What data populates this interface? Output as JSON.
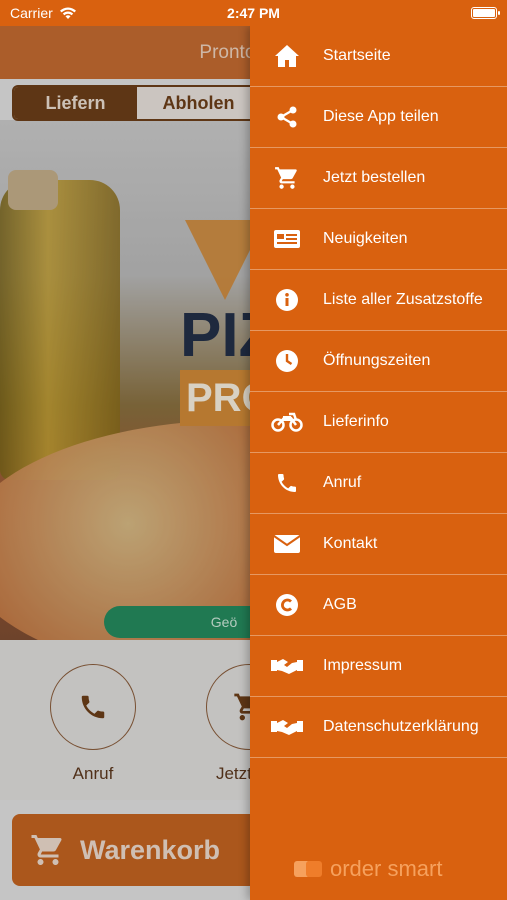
{
  "status": {
    "carrier": "Carrier",
    "time": "2:47 PM"
  },
  "app": {
    "title": "Pronto Pi",
    "tabs": [
      {
        "label": "Liefern",
        "active": true
      },
      {
        "label": "Abholen",
        "active": false
      }
    ],
    "logo": {
      "line1": "PIZ",
      "line2": "PRO"
    },
    "open_status": "Geö",
    "actions": [
      {
        "label": "Anruf",
        "icon": "phone-icon"
      },
      {
        "label": "Jetzt b",
        "icon": "cart-icon"
      }
    ],
    "cart_label": "Warenkorb"
  },
  "drawer": {
    "items": [
      {
        "label": "Startseite",
        "icon": "home-icon"
      },
      {
        "label": "Diese App teilen",
        "icon": "share-icon"
      },
      {
        "label": "Jetzt bestellen",
        "icon": "cart-icon"
      },
      {
        "label": "Neuigkeiten",
        "icon": "news-icon"
      },
      {
        "label": "Liste aller Zusatzstoffe",
        "icon": "info-icon"
      },
      {
        "label": "Öffnungszeiten",
        "icon": "clock-icon"
      },
      {
        "label": "Lieferinfo",
        "icon": "motorcycle-icon"
      },
      {
        "label": "Anruf",
        "icon": "phone-icon"
      },
      {
        "label": "Kontakt",
        "icon": "envelope-icon"
      },
      {
        "label": "AGB",
        "icon": "copyright-icon"
      },
      {
        "label": "Impressum",
        "icon": "handshake-icon"
      },
      {
        "label": "Datenschutzerklärung",
        "icon": "handshake-icon"
      }
    ],
    "brand": "order smart"
  },
  "colors": {
    "accent": "#d9610f",
    "dark_brown": "#6b3a12",
    "green": "#1f8b5c"
  }
}
